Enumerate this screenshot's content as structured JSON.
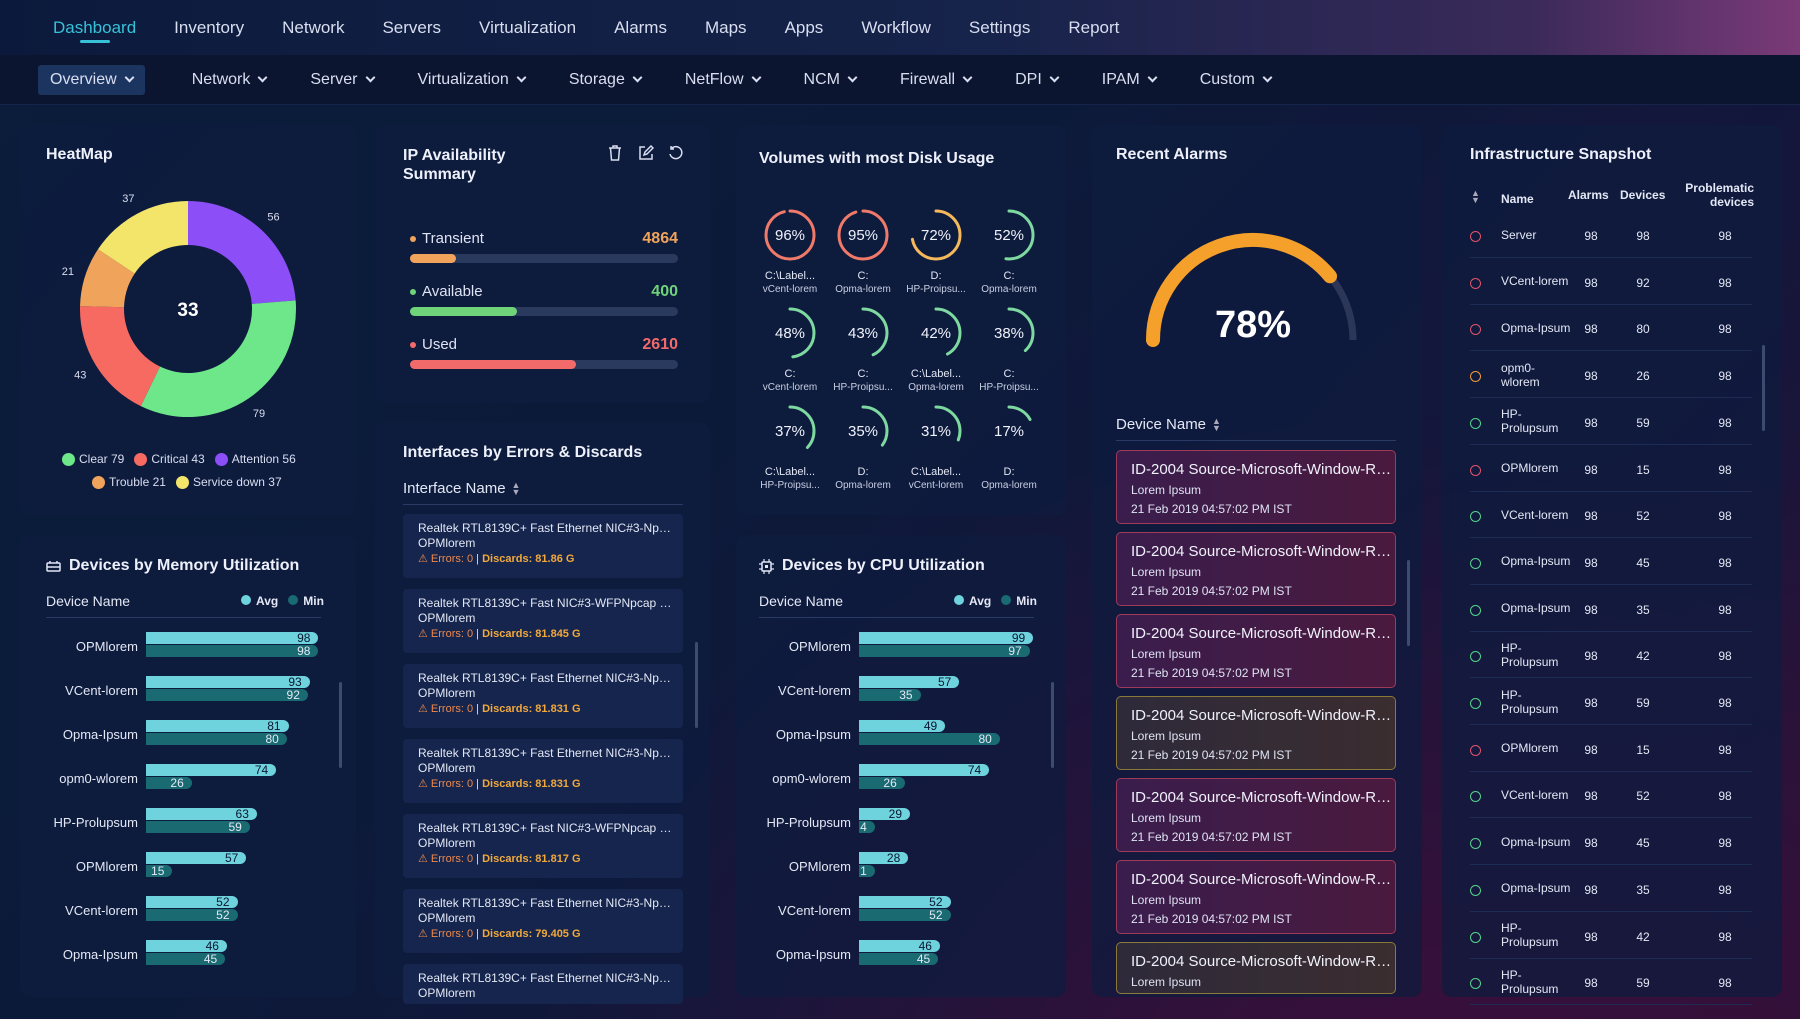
{
  "colors": {
    "accent": "#38c2d8",
    "clear": "#6ee68a",
    "critical": "#f76a62",
    "attention": "#8b4ef7",
    "trouble": "#f0a35a",
    "service_down": "#f3e46a",
    "bar_avg": "#6fd3de",
    "bar_min": "#1a6a72",
    "transient": "#f0a35a",
    "available": "#6fd37a",
    "used": "#f36a6a",
    "gauge": "#f5a02a"
  },
  "topnav": [
    "Dashboard",
    "Inventory",
    "Network",
    "Servers",
    "Virtualization",
    "Alarms",
    "Maps",
    "Apps",
    "Workflow",
    "Settings",
    "Report"
  ],
  "subnav": [
    "Overview",
    "Network",
    "Server",
    "Virtualization",
    "Storage",
    "NetFlow",
    "NCM",
    "Firewall",
    "DPI",
    "IPAM",
    "Custom"
  ],
  "heatmap": {
    "title": "HeatMap",
    "center": "33",
    "segment_labels": [
      "56",
      "79",
      "43",
      "21",
      "37"
    ],
    "legend": [
      {
        "label": "Clear 79"
      },
      {
        "label": "Critical 43"
      },
      {
        "label": "Attention 56"
      },
      {
        "label": "Trouble 21"
      },
      {
        "label": "Service down 37"
      }
    ]
  },
  "ip": {
    "title": "IP Availability Summary",
    "items": [
      {
        "label": "Transient",
        "value": "4864",
        "fill": 0.17
      },
      {
        "label": "Available",
        "value": "400",
        "fill": 0.4
      },
      {
        "label": "Used",
        "value": "2610",
        "fill": 0.62
      }
    ]
  },
  "interfaces": {
    "title": "Interfaces by Errors & Discards",
    "header": "Interface Name",
    "rows": [
      {
        "name": "Realtek RTL8139C+ Fast Ethernet NIC#3-Npcap",
        "device": "OPMlorem",
        "errors": "Errors: 0",
        "discards": "Discards: 81.86 G"
      },
      {
        "name": "Realtek RTL8139C+ Fast NIC#3-WFPNpcap Packet",
        "device": "OPMlorem",
        "errors": "Errors: 0",
        "discards": "Discards: 81.845 G"
      },
      {
        "name": "Realtek RTL8139C+ Fast Ethernet NIC#3-Npcap",
        "device": "OPMlorem",
        "errors": "Errors: 0",
        "discards": "Discards: 81.831 G"
      },
      {
        "name": "Realtek RTL8139C+ Fast Ethernet NIC#3-Npcap",
        "device": "OPMlorem",
        "errors": "Errors: 0",
        "discards": "Discards: 81.831 G"
      },
      {
        "name": "Realtek RTL8139C+ Fast NIC#3-WFPNpcap Packet",
        "device": "OPMlorem",
        "errors": "Errors: 0",
        "discards": "Discards: 81.817 G"
      },
      {
        "name": "Realtek RTL8139C+ Fast Ethernet NIC#3-Npcap",
        "device": "OPMlorem",
        "errors": "Errors: 0",
        "discards": "Discards: 79.405 G"
      },
      {
        "name": "Realtek RTL8139C+ Fast Ethernet NIC#3-Npcap",
        "device": "OPMlorem",
        "errors": "",
        "discards": ""
      }
    ]
  },
  "disk": {
    "title": "Volumes with most Disk Usage",
    "items": [
      {
        "pct": 96,
        "l1": "C:\\Label...",
        "l2": "vCent-lorem"
      },
      {
        "pct": 95,
        "l1": "C:",
        "l2": "Opma-lorem"
      },
      {
        "pct": 72,
        "l1": "D:",
        "l2": "HP-Proipsu..."
      },
      {
        "pct": 52,
        "l1": "C:",
        "l2": "Opma-lorem"
      },
      {
        "pct": 48,
        "l1": "C:",
        "l2": "vCent-lorem"
      },
      {
        "pct": 43,
        "l1": "C:",
        "l2": "HP-Proipsu..."
      },
      {
        "pct": 42,
        "l1": "C:\\Label...",
        "l2": "Opma-lorem"
      },
      {
        "pct": 38,
        "l1": "C:",
        "l2": "HP-Proipsu..."
      },
      {
        "pct": 37,
        "l1": "C:\\Label...",
        "l2": "HP-Proipsu..."
      },
      {
        "pct": 35,
        "l1": "D:",
        "l2": "Opma-lorem"
      },
      {
        "pct": 31,
        "l1": "C:\\Label...",
        "l2": "vCent-lorem"
      },
      {
        "pct": 17,
        "l1": "D:",
        "l2": "Opma-lorem"
      }
    ]
  },
  "memory": {
    "title": "Devices by Memory Utilization",
    "header": "Device Name",
    "avg_label": "Avg",
    "min_label": "Min",
    "rows": [
      {
        "name": "OPMlorem",
        "avg": 98,
        "min": 98
      },
      {
        "name": "VCent-lorem",
        "avg": 93,
        "min": 92
      },
      {
        "name": "Opma-Ipsum",
        "avg": 81,
        "min": 80
      },
      {
        "name": "opm0-wlorem",
        "avg": 74,
        "min": 26
      },
      {
        "name": "HP-Prolupsum",
        "avg": 63,
        "min": 59
      },
      {
        "name": "OPMlorem",
        "avg": 57,
        "min": 15
      },
      {
        "name": "VCent-lorem",
        "avg": 52,
        "min": 52
      },
      {
        "name": "Opma-Ipsum",
        "avg": 46,
        "min": 45
      }
    ]
  },
  "cpu": {
    "title": "Devices by CPU Utilization",
    "header": "Device Name",
    "avg_label": "Avg",
    "min_label": "Min",
    "rows": [
      {
        "name": "OPMlorem",
        "avg": 99,
        "min": 97
      },
      {
        "name": "VCent-lorem",
        "avg": 57,
        "min": 35
      },
      {
        "name": "Opma-Ipsum",
        "avg": 49,
        "min": 80
      },
      {
        "name": "opm0-wlorem",
        "avg": 74,
        "min": 26
      },
      {
        "name": "HP-Prolupsum",
        "avg": 29,
        "min": 4
      },
      {
        "name": "OPMlorem",
        "avg": 28,
        "min": 1
      },
      {
        "name": "VCent-lorem",
        "avg": 52,
        "min": 52
      },
      {
        "name": "Opma-Ipsum",
        "avg": 46,
        "min": 45
      }
    ]
  },
  "alarms": {
    "title": "Recent Alarms",
    "gauge_value": 78,
    "gauge_label": "78%",
    "header": "Device Name",
    "rows": [
      {
        "title": "ID-2004 Source-Microsoft-Window-Resource",
        "desc": "Lorem Ipsum",
        "time": "21 Feb 2019 04:57:02 PM IST",
        "level": "critical"
      },
      {
        "title": "ID-2004 Source-Microsoft-Window-Resource",
        "desc": "Lorem Ipsum",
        "time": "21 Feb 2019 04:57:02 PM IST",
        "level": "critical"
      },
      {
        "title": "ID-2004 Source-Microsoft-Window-Resource",
        "desc": "Lorem Ipsum",
        "time": "21 Feb 2019 04:57:02 PM IST",
        "level": "critical"
      },
      {
        "title": "ID-2004 Source-Microsoft-Window-Resource",
        "desc": "Lorem Ipsum",
        "time": "21 Feb 2019 04:57:02 PM IST",
        "level": "warning"
      },
      {
        "title": "ID-2004 Source-Microsoft-Window-Resource",
        "desc": "Lorem Ipsum",
        "time": "21 Feb 2019 04:57:02 PM IST",
        "level": "critical"
      },
      {
        "title": "ID-2004 Source-Microsoft-Window-Resource",
        "desc": "Lorem Ipsum",
        "time": "21 Feb 2019 04:57:02 PM IST",
        "level": "critical"
      },
      {
        "title": "ID-2004 Source-Microsoft-Window-Resource",
        "desc": "Lorem Ipsum",
        "time": "",
        "level": "warning"
      }
    ]
  },
  "infra": {
    "title": "Infrastructure Snapshot",
    "headers": {
      "name": "Name",
      "alarms": "Alarms",
      "devices": "Devices",
      "problematic": "Problematic devices"
    },
    "rows": [
      {
        "name": "Server",
        "alarms": "98",
        "devices": "98",
        "problematic": "98",
        "status": "critical"
      },
      {
        "name": "VCent-lorem",
        "alarms": "98",
        "devices": "92",
        "problematic": "98",
        "status": "critical"
      },
      {
        "name": "Opma-Ipsum",
        "alarms": "98",
        "devices": "80",
        "problematic": "98",
        "status": "critical"
      },
      {
        "name": "opm0-wlorem",
        "alarms": "98",
        "devices": "26",
        "problematic": "98",
        "status": "warning"
      },
      {
        "name": "HP-Prolupsum",
        "alarms": "98",
        "devices": "59",
        "problematic": "98",
        "status": "ok"
      },
      {
        "name": "OPMlorem",
        "alarms": "98",
        "devices": "15",
        "problematic": "98",
        "status": "critical"
      },
      {
        "name": "VCent-lorem",
        "alarms": "98",
        "devices": "52",
        "problematic": "98",
        "status": "ok"
      },
      {
        "name": "Opma-Ipsum",
        "alarms": "98",
        "devices": "45",
        "problematic": "98",
        "status": "ok"
      },
      {
        "name": "Opma-Ipsum",
        "alarms": "98",
        "devices": "35",
        "problematic": "98",
        "status": "ok"
      },
      {
        "name": "HP-Prolupsum",
        "alarms": "98",
        "devices": "42",
        "problematic": "98",
        "status": "ok"
      },
      {
        "name": "HP-Prolupsum",
        "alarms": "98",
        "devices": "59",
        "problematic": "98",
        "status": "ok"
      },
      {
        "name": "OPMlorem",
        "alarms": "98",
        "devices": "15",
        "problematic": "98",
        "status": "critical"
      },
      {
        "name": "VCent-lorem",
        "alarms": "98",
        "devices": "52",
        "problematic": "98",
        "status": "ok"
      },
      {
        "name": "Opma-Ipsum",
        "alarms": "98",
        "devices": "45",
        "problematic": "98",
        "status": "ok"
      },
      {
        "name": "Opma-Ipsum",
        "alarms": "98",
        "devices": "35",
        "problematic": "98",
        "status": "ok"
      },
      {
        "name": "HP-Prolupsum",
        "alarms": "98",
        "devices": "42",
        "problematic": "98",
        "status": "ok"
      },
      {
        "name": "HP-Prolupsum",
        "alarms": "98",
        "devices": "59",
        "problematic": "98",
        "status": "ok"
      }
    ]
  }
}
